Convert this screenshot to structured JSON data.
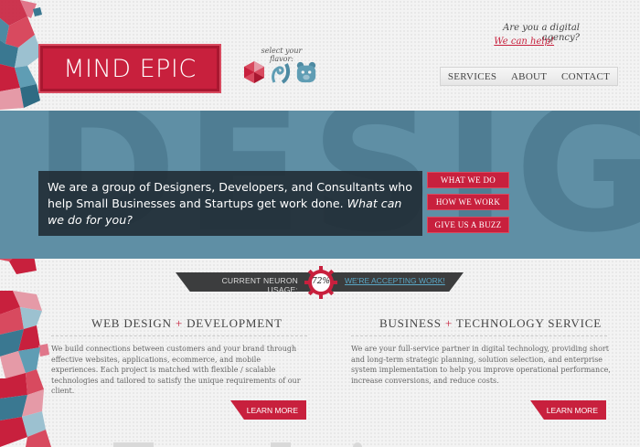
{
  "header": {
    "logo_text": "MIND EPIC",
    "flavor_label": "select your flavor:",
    "flavors": [
      "hexagon-flavor-icon",
      "swirl-flavor-icon",
      "bear-flavor-icon"
    ],
    "agency_question": "Are you a digital agency?",
    "agency_link": "We can help!",
    "nav": [
      "SERVICES",
      "ABOUT",
      "CONTACT"
    ]
  },
  "banner": {
    "background_text": "DESIGN EPIC",
    "intro": "We are a group of Designers, Developers, and Consultants who help Small Businesses and Startups get work done.",
    "intro_question": "What can we do for you?",
    "buttons": [
      "WHAT WE DO",
      "HOW WE WORK",
      "GIVE US A BUZZ"
    ]
  },
  "usage": {
    "label": "CURRENT NEURON USAGE:",
    "value": "72%",
    "link": "WE'RE ACCEPTING WORK!"
  },
  "services": [
    {
      "title_left": "WEB DESIGN",
      "plus": "+",
      "title_right": "DEVELOPMENT",
      "body": "We build connections between customers and your brand through effective websites, applications, ecommerce, and mobile experiences. Each project is matched with flexible / scalable technologies and tailored to satisfy the unique requirements of our client.",
      "button": "LEARN MORE"
    },
    {
      "title_left": "BUSINESS",
      "plus": "+",
      "title_right": "TECHNOLOGY SERVICE",
      "body": "We are your full-service partner in digital technology, providing short and long-term strategic planning, solution selection, and enterprise system implementation to help you improve operational performance, increase conversions, and reduce costs.",
      "button": "LEARN MORE"
    }
  ],
  "colors": {
    "accent": "#c8203d",
    "banner": "#5f8fa5",
    "ribbon": "#3c3d3e",
    "link_blue": "#5aa6c4"
  }
}
